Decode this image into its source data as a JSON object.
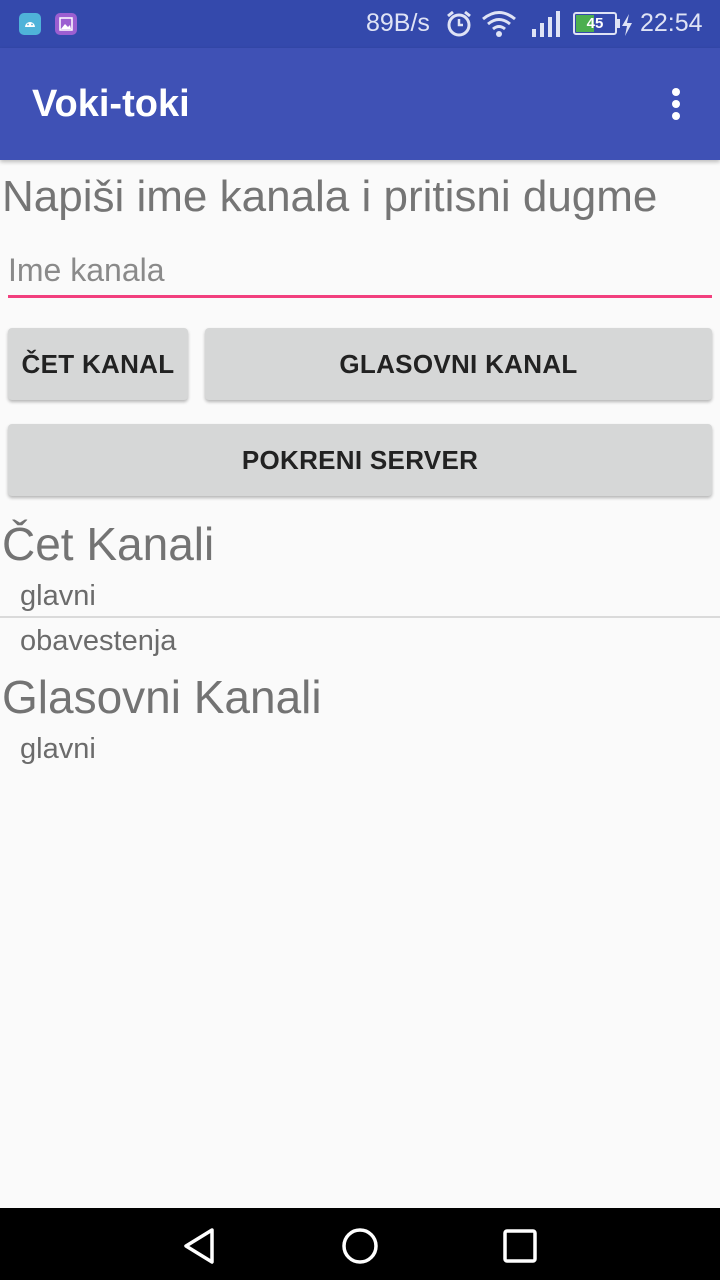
{
  "status_bar": {
    "net_speed": "89B/s",
    "battery_level": "45",
    "time": "22:54",
    "icons": [
      "android-debug-icon",
      "gallery-icon",
      "alarm-icon",
      "wifi-icon",
      "signal-icon",
      "battery-icon",
      "charging-icon"
    ]
  },
  "app_bar": {
    "title": "Voki-toki",
    "menu_icon": "overflow-menu-icon"
  },
  "main": {
    "prompt": "Napiši ime kanala i pritisni dugme",
    "channel_input": {
      "value": "",
      "placeholder": "Ime kanala"
    },
    "buttons": {
      "chat_channel": "ČET KANAL",
      "voice_channel": "GLASOVNI KANAL",
      "start_server": "POKRENI SERVER"
    },
    "chat_section": {
      "title": "Čet Kanali",
      "items": [
        "glavni",
        "obavestenja"
      ]
    },
    "voice_section": {
      "title": "Glasovni Kanali",
      "items": [
        "glavni"
      ]
    }
  },
  "nav_bar": {
    "icons": [
      "back-icon",
      "home-icon",
      "recents-icon"
    ]
  },
  "colors": {
    "status_bar": "#3449ac",
    "app_bar": "#3f51b5",
    "accent": "#f23f7e",
    "button": "#d6d7d7",
    "background": "#fafafa",
    "battery": "#4caf50"
  }
}
